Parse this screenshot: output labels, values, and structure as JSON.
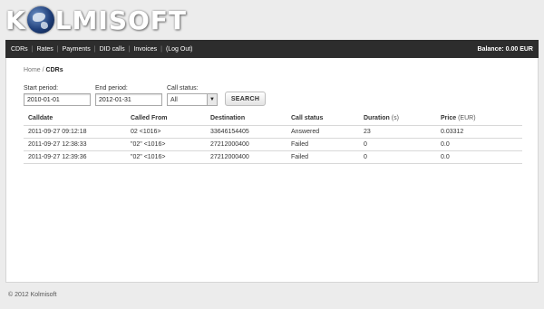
{
  "logo": {
    "prefix": "K",
    "suffix": "LMISOFT"
  },
  "nav": {
    "items": [
      "CDRs",
      "Rates",
      "Payments",
      "DID calls",
      "Invoices",
      "(Log Out)"
    ],
    "separator": "|",
    "balance": "Balance: 0.00 EUR"
  },
  "breadcrumb": {
    "home": "Home",
    "separator": " / ",
    "current": "CDRs"
  },
  "filters": {
    "start_label": "Start period:",
    "start_value": "2010-01-01",
    "end_label": "End period:",
    "end_value": "2012-01-31",
    "status_label": "Call status:",
    "status_value": "All",
    "search_label": "SEARCH"
  },
  "table": {
    "headers": {
      "calldate": "Calldate",
      "called_from": "Called From",
      "destination": "Destination",
      "call_status": "Call status",
      "duration": "Duration",
      "duration_unit": "(s)",
      "price": "Price",
      "price_unit": "(EUR)"
    },
    "rows": [
      [
        "2011-09-27 09:12:18",
        "02 <1016>",
        "33646154405",
        "Answered",
        "23",
        "0.03312"
      ],
      [
        "2011-09-27 12:38:33",
        "\"02\" <1016>",
        "27212000400",
        "Failed",
        "0",
        "0.0"
      ],
      [
        "2011-09-27 12:39:36",
        "\"02\" <1016>",
        "27212000400",
        "Failed",
        "0",
        "0.0"
      ]
    ]
  },
  "footer": {
    "text": "© 2012 Kolmisoft"
  }
}
